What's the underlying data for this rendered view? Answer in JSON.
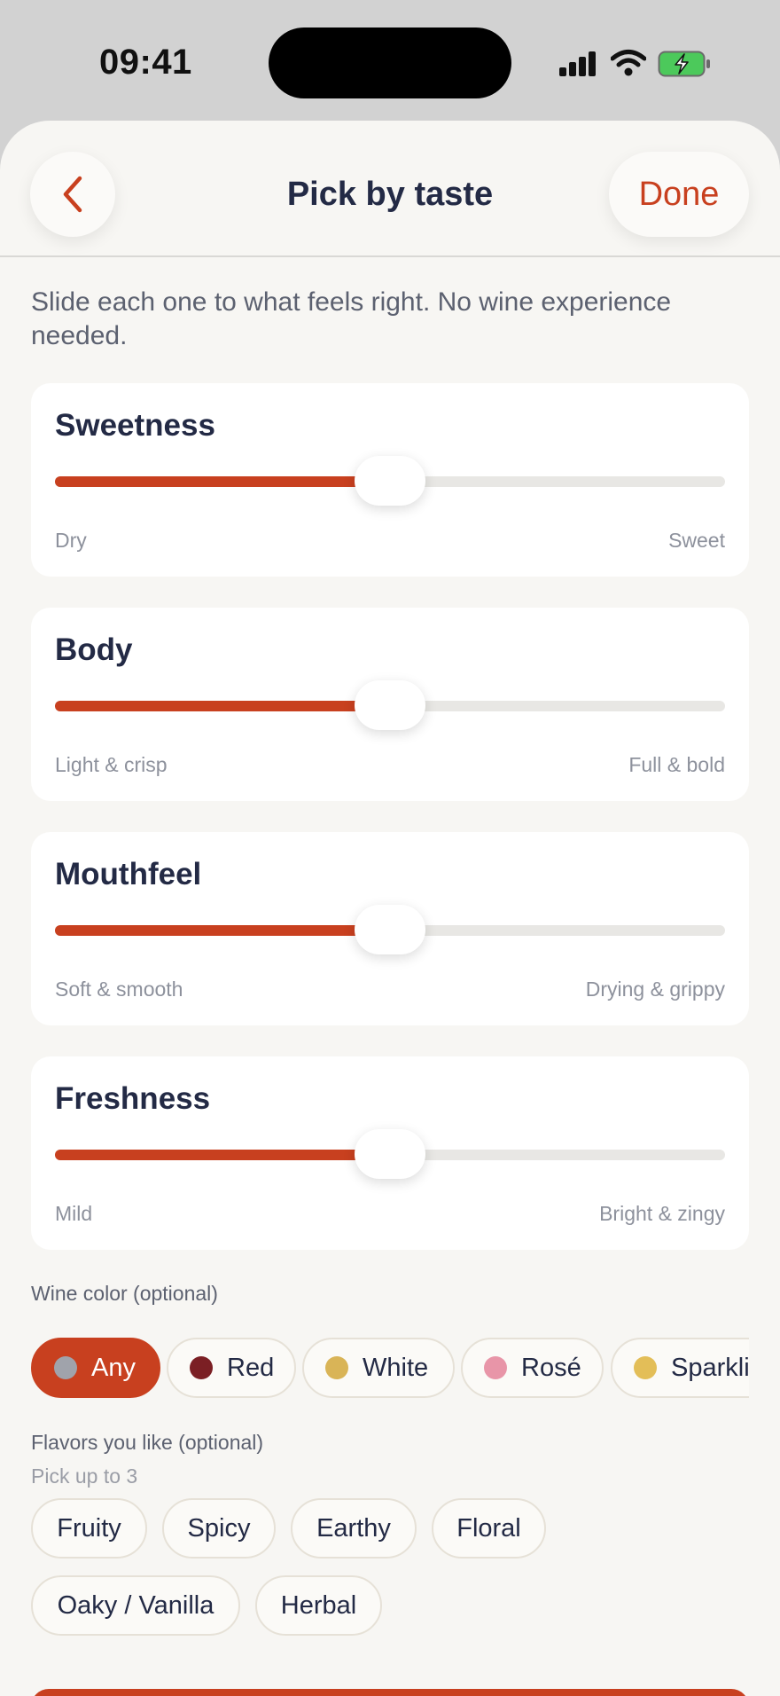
{
  "status": {
    "time": "09:41"
  },
  "nav": {
    "title": "Pick by taste",
    "done_label": "Done"
  },
  "intro": "Slide each one to what feels right. No wine experience needed.",
  "sliders": [
    {
      "title": "Sweetness",
      "left": "Dry",
      "right": "Sweet",
      "value": 0.5
    },
    {
      "title": "Body",
      "left": "Light & crisp",
      "right": "Full & bold",
      "value": 0.5
    },
    {
      "title": "Mouthfeel",
      "left": "Soft & smooth",
      "right": "Drying & grippy",
      "value": 0.5
    },
    {
      "title": "Freshness",
      "left": "Mild",
      "right": "Bright & zingy",
      "value": 0.5
    }
  ],
  "wine_color": {
    "label": "Wine color (optional)",
    "selected": "Any",
    "options": [
      {
        "label": "Any",
        "dot": "#a0a3ab"
      },
      {
        "label": "Red",
        "dot": "#7b1f24"
      },
      {
        "label": "White",
        "dot": "#d9b457"
      },
      {
        "label": "Rosé",
        "dot": "#e895a8"
      },
      {
        "label": "Sparkli",
        "dot": "#e3be58"
      }
    ]
  },
  "flavors": {
    "label": "Flavors you like (optional)",
    "sub": "Pick up to 3",
    "options": [
      "Fruity",
      "Spicy",
      "Earthy",
      "Floral",
      "Oaky / Vanilla",
      "Herbal"
    ]
  },
  "colors": {
    "accent": "#c8401f",
    "text": "#232a45",
    "muted": "#8d919c",
    "background": "#f7f6f3"
  }
}
